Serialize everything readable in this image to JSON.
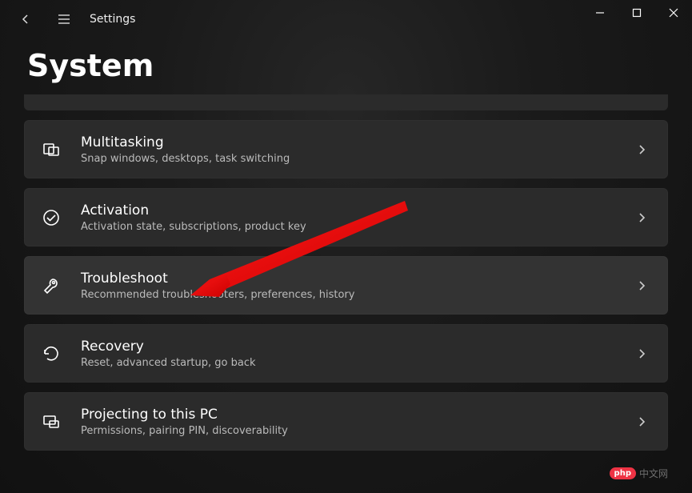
{
  "app": {
    "title": "Settings",
    "page_heading": "System"
  },
  "items": [
    {
      "key": "multitasking",
      "icon": "multitasking-icon",
      "title": "Multitasking",
      "subtitle": "Snap windows, desktops, task switching",
      "hover": false
    },
    {
      "key": "activation",
      "icon": "activation-icon",
      "title": "Activation",
      "subtitle": "Activation state, subscriptions, product key",
      "hover": false
    },
    {
      "key": "troubleshoot",
      "icon": "troubleshoot-icon",
      "title": "Troubleshoot",
      "subtitle": "Recommended troubleshooters, preferences, history",
      "hover": true
    },
    {
      "key": "recovery",
      "icon": "recovery-icon",
      "title": "Recovery",
      "subtitle": "Reset, advanced startup, go back",
      "hover": false
    },
    {
      "key": "projecting",
      "icon": "projecting-icon",
      "title": "Projecting to this PC",
      "subtitle": "Permissions, pairing PIN, discoverability",
      "hover": false
    }
  ],
  "annotation": {
    "type": "arrow",
    "color": "#ff0000",
    "points_to": "troubleshoot"
  },
  "watermark": {
    "brand": "php",
    "text": "中文网"
  }
}
